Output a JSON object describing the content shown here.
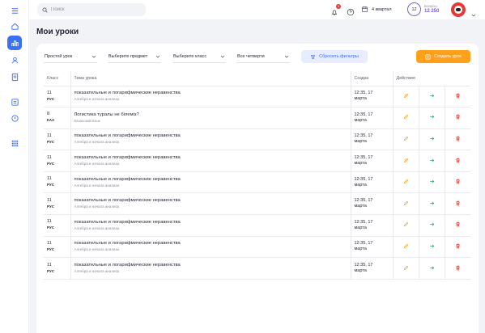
{
  "topbar": {
    "search_placeholder": "Поиск",
    "notification_count": "1",
    "quarter_label": "4 квартал",
    "level": "12",
    "bonus_label": "Бонусы",
    "bonus_value": "12 250"
  },
  "page": {
    "title": "Мои уроки"
  },
  "filters": {
    "lesson_type": "Простой урок",
    "subject": "Выберите предмет",
    "grade": "Выберите класс",
    "quarter": "Все четверти",
    "reset_label": "Сбросить фильтры",
    "create_label": "Создать урок"
  },
  "table": {
    "headers": {
      "grade": "Класс",
      "topic": "Тема урока",
      "created": "Создан",
      "actions": "Действия"
    },
    "rows": [
      {
        "grade": "11",
        "lang": "РУС",
        "topic": "показательные и логарифмические неравенства",
        "subject": "Алгебра и начала анализа",
        "created_time": "12:35, 17",
        "created_month": "марта"
      },
      {
        "grade": "8",
        "lang": "КАЗ",
        "topic": "Логистика туралы не білеміз?",
        "subject": "Казахский язык",
        "created_time": "12:35, 17",
        "created_month": "марта"
      },
      {
        "grade": "11",
        "lang": "РУС",
        "topic": "показательные и логарифмические неравенства",
        "subject": "Алгебра и начала анализа",
        "created_time": "12:35, 17",
        "created_month": "марта"
      },
      {
        "grade": "11",
        "lang": "РУС",
        "topic": "показательные и логарифмические неравенства",
        "subject": "Алгебра и начала анализа",
        "created_time": "12:35, 17",
        "created_month": "марта"
      },
      {
        "grade": "11",
        "lang": "РУС",
        "topic": "показательные и логарифмические неравенства",
        "subject": "Алгебра и начала анализа",
        "created_time": "12:35, 17",
        "created_month": "марта"
      },
      {
        "grade": "11",
        "lang": "РУС",
        "topic": "показательные и логарифмические неравенства",
        "subject": "Алгебра и начала анализа",
        "created_time": "12:35, 17",
        "created_month": "марта"
      },
      {
        "grade": "11",
        "lang": "РУС",
        "topic": "показательные и логарифмические неравенства",
        "subject": "Алгебра и начала анализа",
        "created_time": "12:35, 17",
        "created_month": "марта"
      },
      {
        "grade": "11",
        "lang": "РУС",
        "topic": "показательные и логарифмические неравенства",
        "subject": "Алгебра и начала анализа",
        "created_time": "12:35, 17",
        "created_month": "марта"
      },
      {
        "grade": "11",
        "lang": "РУС",
        "topic": "показательные и логарифмические неравенства",
        "subject": "Алгебра и начала анализа",
        "created_time": "12:35, 17",
        "created_month": "марта"
      }
    ]
  },
  "colors": {
    "accent": "#3b6ff5",
    "create": "#ff9f1a",
    "delete": "#e53935",
    "go": "#22a55b",
    "bonus": "#7b5cf0"
  },
  "icons": {
    "sidebar": [
      "menu-icon",
      "home-icon",
      "lessons-icon",
      "user-icon",
      "book-icon",
      "calendar-icon",
      "help-icon",
      "apps-icon"
    ],
    "row_actions": [
      "pencil-icon",
      "arrow-right-icon",
      "trash-icon"
    ]
  }
}
